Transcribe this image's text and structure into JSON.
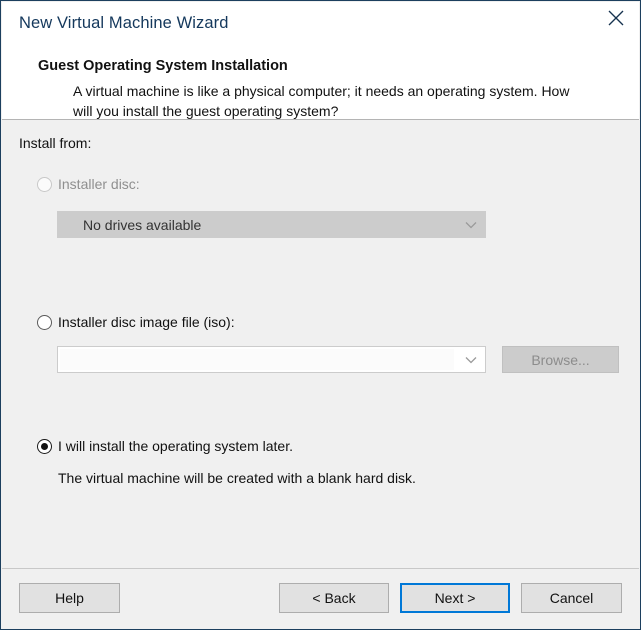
{
  "window": {
    "title": "New Virtual Machine Wizard",
    "close_icon": "close-icon"
  },
  "header": {
    "heading": "Guest Operating System Installation",
    "description": "A virtual machine is like a physical computer; it needs an operating system. How will you install the guest operating system?"
  },
  "body": {
    "install_from_label": "Install from:",
    "options": [
      {
        "label": "Installer disc:",
        "selected": false,
        "enabled": false,
        "combo_value": "No drives available",
        "combo_enabled": false
      },
      {
        "label": "Installer disc image file (iso):",
        "selected": false,
        "enabled": true,
        "combo_value": "",
        "combo_enabled": true,
        "browse_label": "Browse...",
        "browse_enabled": false
      },
      {
        "label": "I will install the operating system later.",
        "selected": true,
        "enabled": true,
        "note": "The virtual machine will be created with a blank hard disk."
      }
    ]
  },
  "footer": {
    "help_label": "Help",
    "back_label": "< Back",
    "next_label": "Next >",
    "cancel_label": "Cancel",
    "default_button": "Next >"
  },
  "colors": {
    "window_border": "#1c3f5e",
    "title_text": "#14385c",
    "body_background": "#f0f0f0",
    "accent_focus": "#0078d7",
    "disabled_text": "#8f8f8f",
    "disabled_control": "#cccccc"
  }
}
